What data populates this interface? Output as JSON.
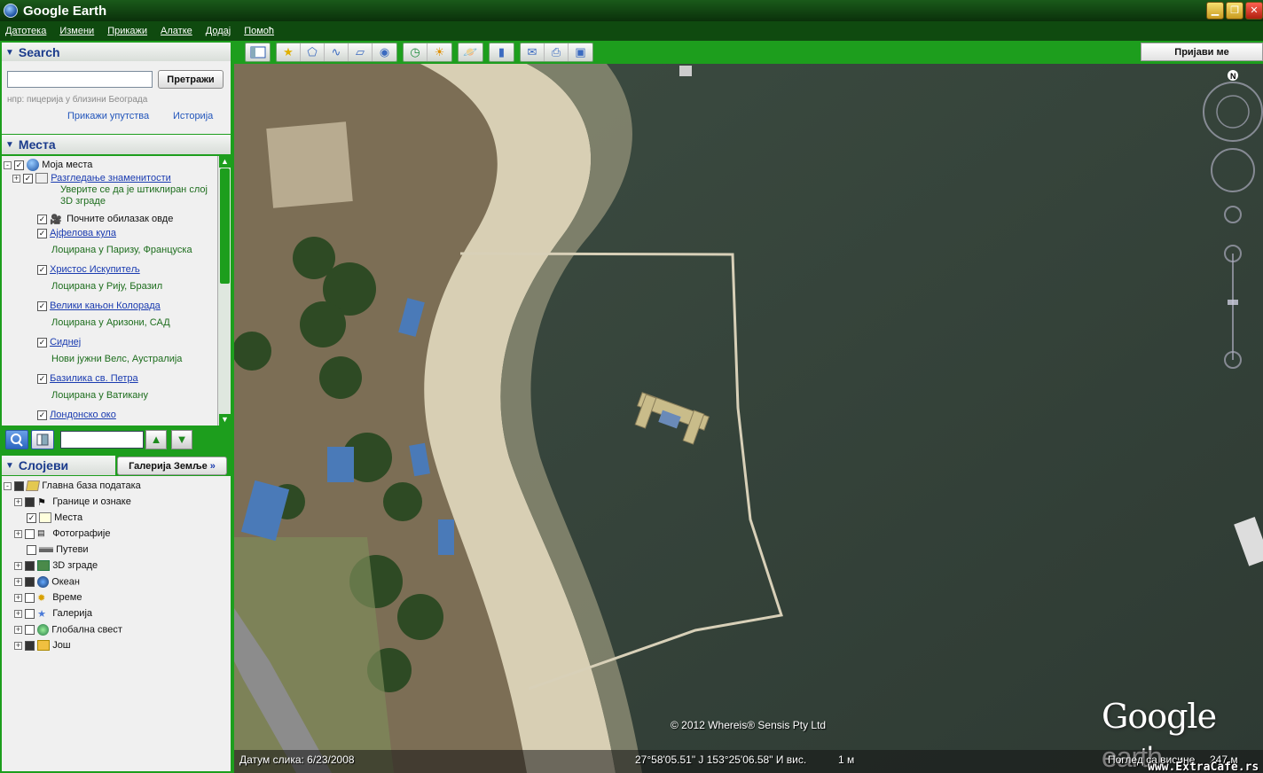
{
  "window": {
    "title": "Google Earth"
  },
  "menu": [
    "Датотека",
    "Измени",
    "Прикажи",
    "Алатке",
    "Додај",
    "Помоћ"
  ],
  "search": {
    "header": "Search",
    "button": "Претражи",
    "placeholder": "",
    "hint": "нпр: пицерија у близини Београда",
    "directions_link": "Прикажи упутства",
    "history_link": "Историја"
  },
  "places": {
    "header": "Места",
    "root": "Моја места",
    "tour_folder": "Разгледање знаменитости",
    "tour_note_1": "Уверите се да је штиклиран слој",
    "tour_note_2": "3D зграде",
    "tour_start": "Почните обилазак овде",
    "items": [
      {
        "name": "Ајфелова кула",
        "desc": "Лоцирана у Паризу, Француска"
      },
      {
        "name": "Христос Искупитељ",
        "desc": "Лоцирана у Рију, Бразил"
      },
      {
        "name": "Велики кањон Колорада",
        "desc": "Лоцирана у Аризони, САД"
      },
      {
        "name": "Сиднеј",
        "desc": "Нови јужни Велс, Аустралија"
      },
      {
        "name": "Базилика св. Петра",
        "desc": "Лоцирана у Ватикану"
      },
      {
        "name": "Лондонско око",
        "desc": ""
      }
    ]
  },
  "layers": {
    "header": "Слојеви",
    "gallery_button": "Галерија Земље",
    "items": [
      {
        "name": "Главна база података",
        "state": "partial"
      },
      {
        "name": "Границе и ознаке",
        "state": "partial"
      },
      {
        "name": "Места",
        "state": "checked"
      },
      {
        "name": "Фотографије",
        "state": "unchecked"
      },
      {
        "name": "Путеви",
        "state": "unchecked"
      },
      {
        "name": "3D зграде",
        "state": "partial"
      },
      {
        "name": "Океан",
        "state": "partial"
      },
      {
        "name": "Време",
        "state": "unchecked"
      },
      {
        "name": "Галерија",
        "state": "unchecked"
      },
      {
        "name": "Глобална свест",
        "state": "unchecked"
      },
      {
        "name": "Још",
        "state": "partial"
      }
    ]
  },
  "toolbar": {
    "login": "Пријави ме",
    "icons": [
      "sidebar-toggle-icon",
      "placemark-icon",
      "polygon-icon",
      "path-icon",
      "image-overlay-icon",
      "record-tour-icon",
      "historical-imagery-icon",
      "sunlight-icon",
      "planets-icon",
      "ruler-icon",
      "email-icon",
      "print-icon",
      "save-image-icon"
    ]
  },
  "map": {
    "copyright": "© 2012 Whereis® Sensis Pty Ltd",
    "brand_google": "Google",
    "brand_earth": "earth",
    "imagery_date": "Датум слика: 6/23/2008",
    "coordinates": "27°58'05.51\" J  153°25'06.58\" И вис.",
    "elevation": "1 м",
    "eye_alt": "Поглед са висине",
    "eye_alt_value": "247 м",
    "watermark": "www.ExtraCafe.rs",
    "compass_north": "N"
  }
}
